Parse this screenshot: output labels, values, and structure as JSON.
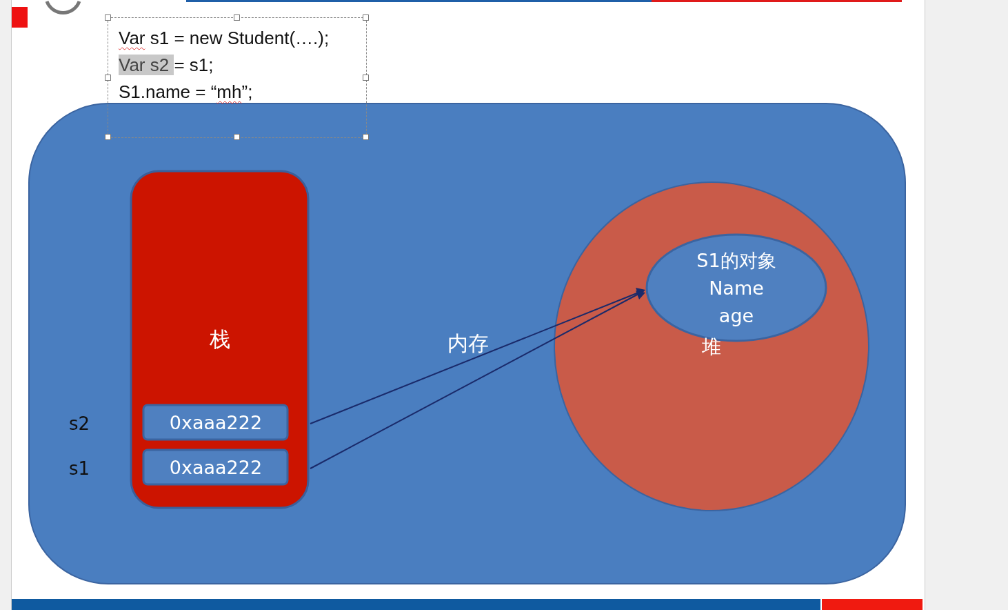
{
  "code_box": {
    "selected": true,
    "lines": [
      [
        {
          "text": "Var",
          "kind": "misspelled"
        },
        {
          "text": " s1 = new Student(….);",
          "kind": "plain"
        }
      ],
      [
        {
          "text": "Var s2 ",
          "kind": "highlighted"
        },
        {
          "text": "= s1;",
          "kind": "plain"
        }
      ],
      [
        {
          "text": "S1.name = “",
          "kind": "plain"
        },
        {
          "text": "mh",
          "kind": "misspelled"
        },
        {
          "text": "”;",
          "kind": "plain"
        }
      ]
    ]
  },
  "diagram": {
    "memory_label": "内存",
    "stack": {
      "label": "栈",
      "slots": [
        {
          "name": "s2",
          "value": "0xaaa222"
        },
        {
          "name": "s1",
          "value": "0xaaa222"
        }
      ]
    },
    "heap": {
      "label": "堆",
      "object_lines": [
        "S1的对象",
        "Name",
        "age"
      ]
    }
  }
}
